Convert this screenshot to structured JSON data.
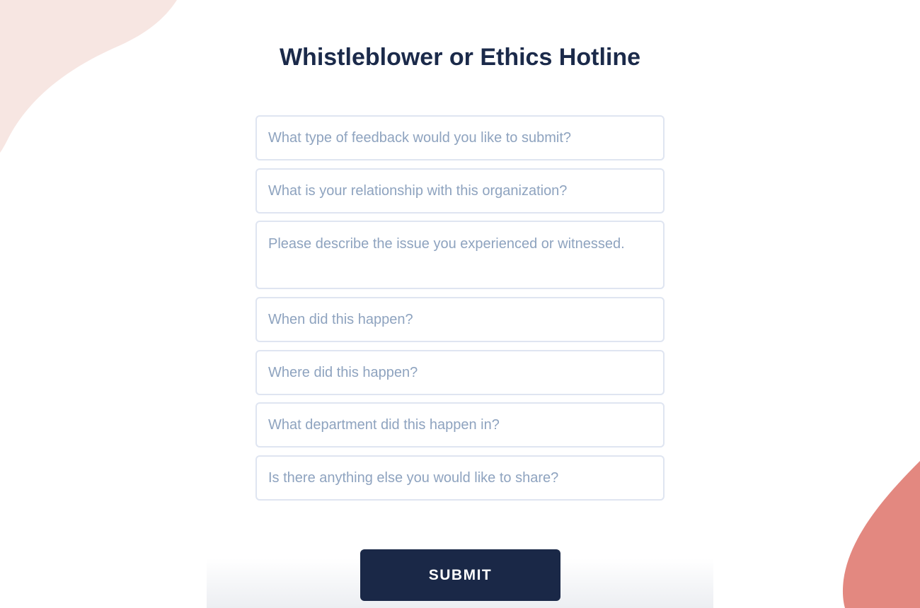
{
  "form": {
    "title": "Whistleblower or Ethics Hotline",
    "fields": [
      {
        "placeholder": "What type of feedback would you like to submit?"
      },
      {
        "placeholder": "What is your relationship with this organization?"
      },
      {
        "placeholder": "Please describe the issue you experienced or witnessed."
      },
      {
        "placeholder": "When did this happen?"
      },
      {
        "placeholder": "Where did this happen?"
      },
      {
        "placeholder": "What department did this happen in?"
      },
      {
        "placeholder": "Is there anything else you would like to share?"
      }
    ],
    "submit_label": "SUBMIT"
  },
  "colors": {
    "title": "#1b2a4a",
    "button_bg": "#1a2847",
    "placeholder": "#8ea3bf",
    "field_border": "#dfe5f1",
    "blob_pink_light": "#f7e6e2",
    "blob_coral": "#e38880"
  }
}
